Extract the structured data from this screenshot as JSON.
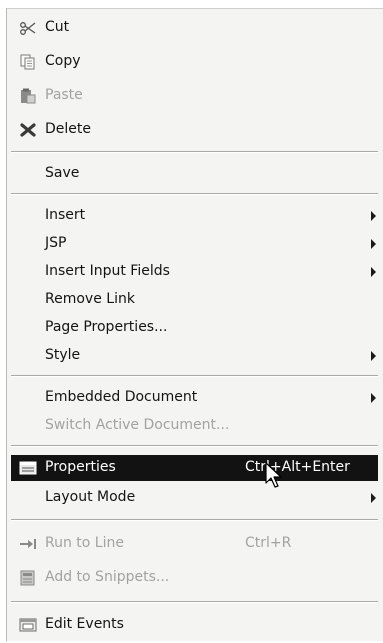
{
  "menu": {
    "cut_label": "Cut",
    "copy_label": "Copy",
    "paste_label": "Paste",
    "delete_label": "Delete",
    "save_label": "Save",
    "insert_label": "Insert",
    "jsp_label": "JSP",
    "insert_input_fields_label": "Insert Input Fields",
    "remove_link_label": "Remove Link",
    "page_properties_label": "Page Properties...",
    "style_label": "Style",
    "embedded_document_label": "Embedded Document",
    "switch_active_document_label": "Switch Active Document...",
    "properties_label": "Properties",
    "properties_shortcut": "Ctrl+Alt+Enter",
    "layout_mode_label": "Layout Mode",
    "run_to_line_label": "Run to Line",
    "run_to_line_shortcut": "Ctrl+R",
    "add_to_snippets_label": "Add to Snippets...",
    "edit_events_label": "Edit Events"
  },
  "icons": {
    "cut": "scissors-icon",
    "copy": "copy-icon",
    "paste": "paste-icon",
    "delete": "delete-icon",
    "properties": "properties-icon",
    "run_to_line": "arrow-right-icon",
    "add_to_snippets": "snippets-icon",
    "edit_events": "events-icon"
  },
  "colors": {
    "menu_background": "#f4f4f2",
    "selection_background": "#121212",
    "disabled_text": "#a2a2a2"
  }
}
